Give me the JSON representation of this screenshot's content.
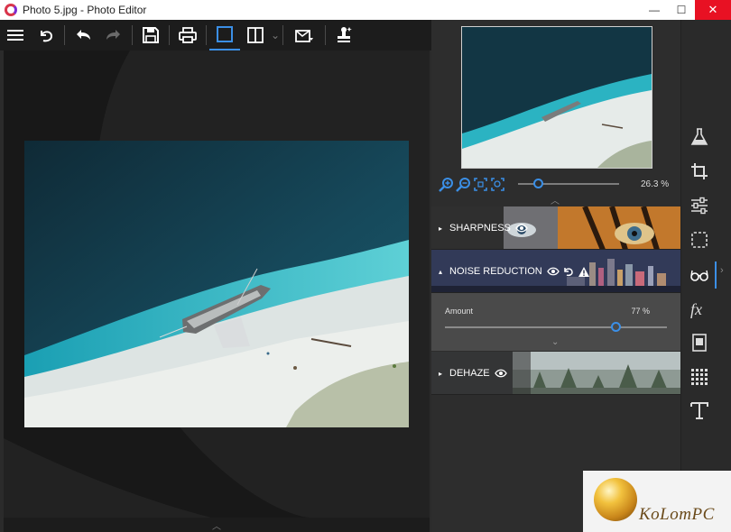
{
  "window": {
    "title": "Photo 5.jpg - Photo Editor",
    "controls": {
      "minimize": "—",
      "maximize": "☐",
      "close": "✕"
    }
  },
  "toolbar": {
    "buttons": [
      {
        "name": "menu",
        "icon": "hamburger-icon"
      },
      {
        "name": "undo-all",
        "icon": "revert-icon"
      },
      {
        "name": "undo",
        "icon": "undo-arrow-icon"
      },
      {
        "name": "redo",
        "icon": "redo-arrow-icon",
        "disabled": true
      },
      {
        "name": "save",
        "icon": "floppy-disk-icon"
      },
      {
        "name": "print",
        "icon": "printer-icon"
      },
      {
        "name": "single-view",
        "icon": "single-pane-icon",
        "active": true
      },
      {
        "name": "split-view",
        "icon": "split-pane-icon"
      },
      {
        "name": "share",
        "icon": "share-icon"
      },
      {
        "name": "stamp",
        "icon": "stamp-icon"
      }
    ],
    "dropdown_glyph": "⌄"
  },
  "canvas": {
    "collapse_glyph": "︿"
  },
  "navigator": {
    "zoom_value": "26.3 %",
    "zoom_fraction": 0.2,
    "collapse_glyph": "︿"
  },
  "adjustments": {
    "sharpness": {
      "label": "SHARPNESS",
      "expanded": false
    },
    "noise_reduction": {
      "label": "NOISE REDUCTION",
      "expanded": true,
      "amount_label": "Amount",
      "amount_value": "77 %",
      "amount_fraction": 0.77
    },
    "dehaze": {
      "label": "DEHAZE",
      "expanded": false
    },
    "expand_glyph": "▸",
    "collapse_glyph": "▴",
    "chevron_glyph": "⌄"
  },
  "side_tools": [
    {
      "name": "effects-flask",
      "icon": "flask-icon"
    },
    {
      "name": "crop",
      "icon": "crop-icon"
    },
    {
      "name": "adjust",
      "icon": "sliders-icon"
    },
    {
      "name": "selection",
      "icon": "selection-icon"
    },
    {
      "name": "details",
      "icon": "glasses-icon",
      "active": true
    },
    {
      "name": "fx",
      "icon": "fx-icon"
    },
    {
      "name": "frames",
      "icon": "frame-icon"
    },
    {
      "name": "texture",
      "icon": "texture-icon"
    },
    {
      "name": "text",
      "icon": "text-icon"
    }
  ],
  "side_collapse_glyph": "›",
  "watermark": {
    "text": "KoLomPC"
  },
  "colors": {
    "accent": "#3b8fe6",
    "panel": "#2d2d2d",
    "toolbar": "#1c1c1c",
    "warning": "#ffffff"
  }
}
